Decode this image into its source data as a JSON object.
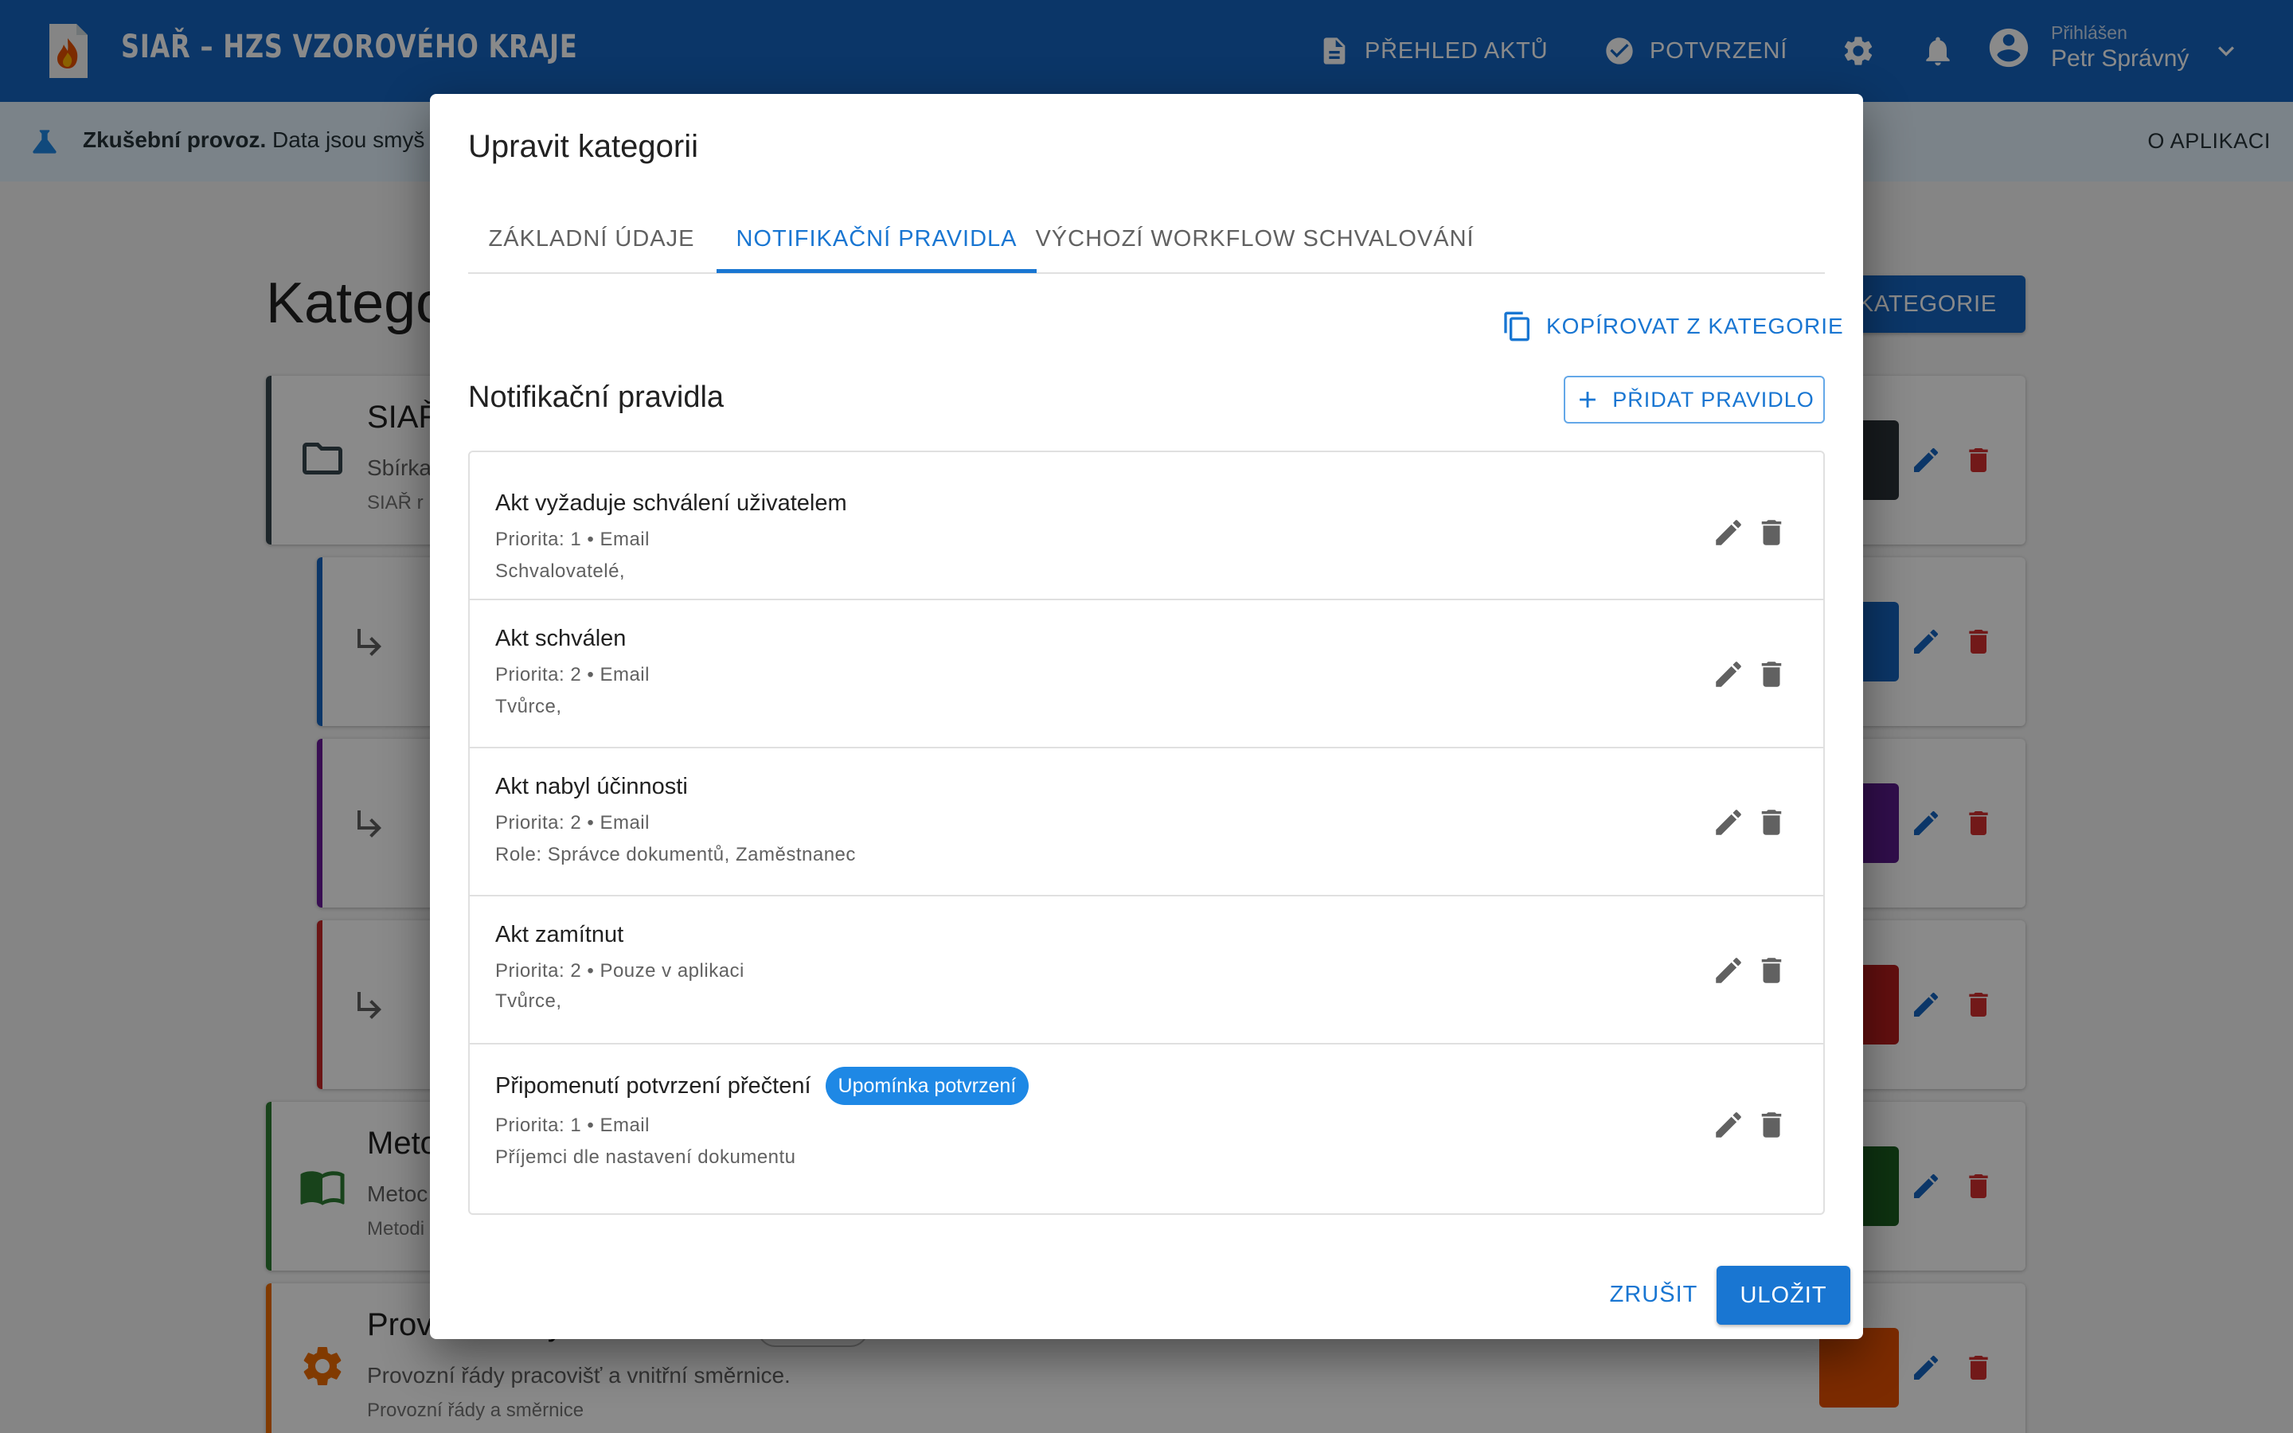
{
  "header": {
    "app_title": "SIAŘ – HZS VZOROVÉHO KRAJE",
    "nav": [
      {
        "label": "PŘEHLED AKTŮ",
        "icon": "document-icon"
      },
      {
        "label": "POTVRZENÍ",
        "icon": "check-circle-icon"
      }
    ],
    "user": {
      "subtitle": "Přihlášen",
      "name": "Petr Správný"
    },
    "primary_color": "#1565c0"
  },
  "banner": {
    "bold": "Zkušební provoz.",
    "text": "Data jsou smyš",
    "link": "O APLIKACI"
  },
  "page": {
    "title": "Katego",
    "add_button": "KATEGORIE",
    "cards": [
      {
        "title": "SIAŘ",
        "desc": "Sbírka",
        "sub": "SIAŘ r",
        "accent": "#37474f",
        "swatch": "#2b3338"
      },
      {
        "title": "",
        "desc": "",
        "sub": "",
        "accent": "#1565c0",
        "swatch": "#1565c0"
      },
      {
        "title": "",
        "desc": "",
        "sub": "",
        "accent": "#6a1b9a",
        "swatch": "#5b1a8c"
      },
      {
        "title": "",
        "desc": "",
        "sub": "",
        "accent": "#c62828",
        "swatch": "#b71c1c"
      },
      {
        "title": "Meto",
        "desc": "Metoc",
        "sub": "Metodi",
        "accent": "#2e7d32",
        "swatch": "#1b5e20"
      },
      {
        "title": "Provozní řády a směrnice",
        "desc": "Provozní řády pracovišť a vnitřní směrnice.",
        "sub": "Provozní řády a směrnice",
        "accent": "#ef6c00",
        "swatch": "#e65100"
      }
    ]
  },
  "dialog": {
    "title": "Upravit kategorii",
    "tabs": [
      {
        "label": "ZÁKLADNÍ ÚDAJE",
        "active": false
      },
      {
        "label": "NOTIFIKAČNÍ PRAVIDLA",
        "active": true
      },
      {
        "label": "VÝCHOZÍ WORKFLOW SCHVALOVÁNÍ",
        "active": false
      }
    ],
    "copy_label": "KOPÍROVAT Z KATEGORIE",
    "section_title": "Notifikační pravidla",
    "add_rule_label": "PŘIDAT PRAVIDLO",
    "rules": [
      {
        "name": "Akt vyžaduje schválení uživatelem",
        "meta": "Priorita: 1 • Email",
        "recipients": "Schvalovatelé,",
        "badge": ""
      },
      {
        "name": "Akt schválen",
        "meta": "Priorita: 2 • Email",
        "recipients": "Tvůrce,",
        "badge": ""
      },
      {
        "name": "Akt nabyl účinnosti",
        "meta": "Priorita: 2 • Email",
        "recipients": "Role: Správce dokumentů, Zaměstnanec",
        "badge": ""
      },
      {
        "name": "Akt zamítnut",
        "meta": "Priorita: 2 • Pouze v aplikaci",
        "recipients": "Tvůrce,",
        "badge": ""
      },
      {
        "name": "Připomenutí potvrzení přečtení",
        "meta": "Priorita: 1 • Email",
        "recipients": "Příjemci dle nastavení dokumentu",
        "badge": "Upomínka potvrzení"
      }
    ],
    "cancel_label": "ZRUŠIT",
    "save_label": "ULOŽIT"
  }
}
